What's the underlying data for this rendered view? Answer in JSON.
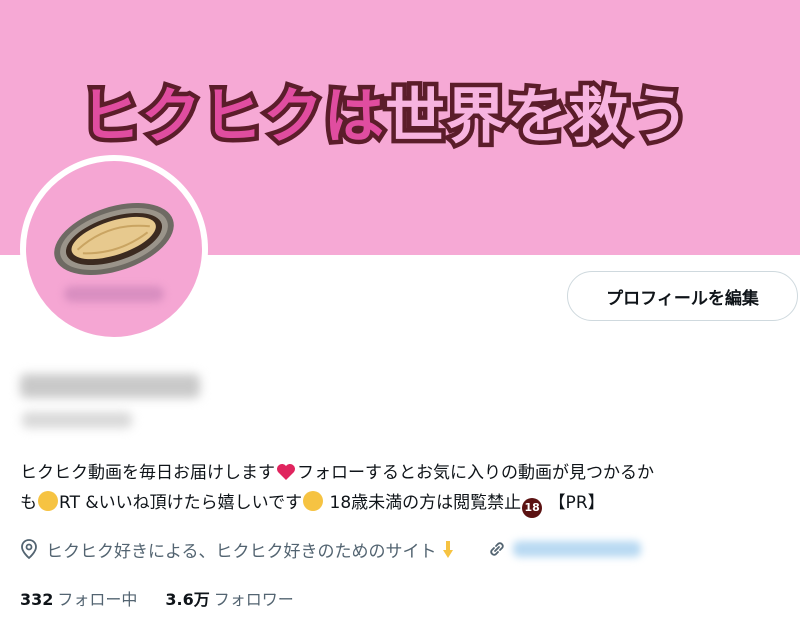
{
  "banner": {
    "title_a": "ヒクヒク",
    "title_b": "は",
    "title_c": "世界を救う"
  },
  "profile": {
    "edit_button": "プロフィールを編集"
  },
  "bio": {
    "line_1a": "ヒクヒク動画を毎日お届けします",
    "line_1b": "フォローするとお気に入りの動画が見つかるか",
    "line_2a": "も",
    "line_2b": "RT &いいね頂けたら嬉しいです",
    "line_2c": "18歳未満の方は閲覧禁止",
    "line_2d": "【PR】",
    "badge_18": "18"
  },
  "meta": {
    "location": "ヒクヒク好きによる、ヒクヒク好きのためのサイト"
  },
  "stats": {
    "following_count": "332",
    "following_label": "フォロー中",
    "followers_count": "3.6万",
    "followers_label": "フォロワー"
  },
  "colors": {
    "banner_bg": "#f6a9d5",
    "title_pink": "#e04da0",
    "title_light": "#f7b4e0",
    "title_outline": "#5b1d2a"
  }
}
